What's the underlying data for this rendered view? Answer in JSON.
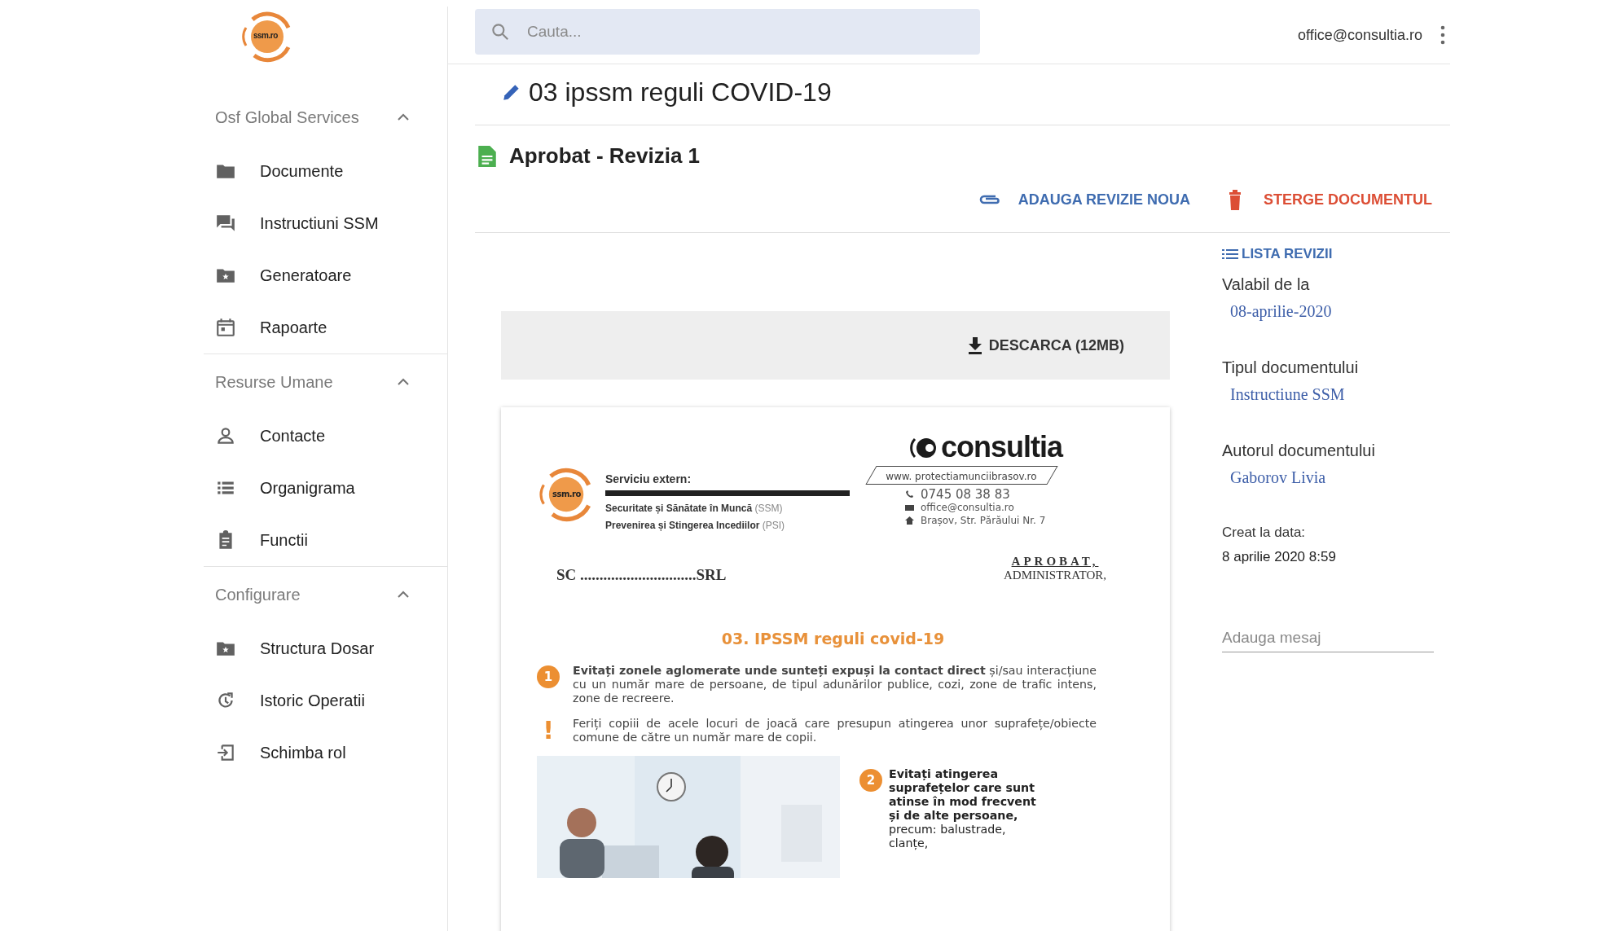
{
  "logo": {
    "text": "ssm.ro"
  },
  "sidebar": {
    "groups": [
      {
        "title": "Osf Global Services",
        "expanded": true,
        "items": [
          {
            "label": "Documente"
          },
          {
            "label": "Instructiuni SSM"
          },
          {
            "label": "Generatoare"
          },
          {
            "label": "Rapoarte"
          }
        ]
      },
      {
        "title": "Resurse Umane",
        "expanded": true,
        "items": [
          {
            "label": "Contacte"
          },
          {
            "label": "Organigrama"
          },
          {
            "label": "Functii"
          }
        ]
      },
      {
        "title": "Configurare",
        "expanded": true,
        "items": [
          {
            "label": "Structura Dosar"
          },
          {
            "label": "Istoric Operatii"
          },
          {
            "label": "Schimba rol"
          }
        ]
      }
    ]
  },
  "search": {
    "placeholder": "Cauta..."
  },
  "user": {
    "email": "office@consultia.ro"
  },
  "document": {
    "title": "03 ipssm reguli COVID-19",
    "revision": "Aprobat - Revizia 1",
    "actions": [
      {
        "kind": "add",
        "label": "ADAUGA REVIZIE NOUA"
      },
      {
        "kind": "delete",
        "label": "STERGE DOCUMENTUL"
      }
    ],
    "download": {
      "label": "DESCARCA (12MB)"
    },
    "preview": {
      "logo_text": "ssm.ro",
      "service_title": "Serviciu extern:",
      "services": [
        {
          "text": "Securitate și Sănătate în Muncă",
          "abbr": "(SSM)"
        },
        {
          "text": "Prevenirea și Stingerea Incediilor",
          "abbr": "(PSI)"
        }
      ],
      "brand": "consultia",
      "website": "www. protectiamunciibrasov.ro",
      "contacts": [
        {
          "kind": "phone",
          "text": "0745 08 38 83"
        },
        {
          "kind": "email",
          "text": "office@consultia.ro"
        },
        {
          "kind": "address",
          "text": "Brașov, Str. Părăului Nr. 7"
        }
      ],
      "company_line": "SC ..............................SRL",
      "approval": {
        "title": "APROBAT,",
        "role": "ADMINISTRATOR,"
      },
      "heading": "03. IPSSM reguli covid-19",
      "rules": [
        {
          "kind": "numbered",
          "marker": "1",
          "text": "**Evitați zonele aglomerate unde sunteți expuși la contact direct** și/sau interacțiune cu un număr mare de persoane, de tipul adunărilor publice, cozi, zone de trafic intens, zone de recreere."
        },
        {
          "kind": "warning",
          "marker": "!",
          "text": "Feriți copiii de acele locuri de joacă care presupun atingerea unor suprafețe/obiecte comune de către un număr mare de copii."
        }
      ],
      "photo_rule": {
        "marker": "2",
        "text": "**Evitați atingerea suprafețelor care sunt atinse în mod frecvent și de alte persoane,** precum: balustrade, clanțe,"
      }
    }
  },
  "details": {
    "revisions_link": "LISTA REVIZII",
    "fields": [
      {
        "kind": "link",
        "label": "Valabil de la",
        "value": "08-aprilie-2020"
      },
      {
        "kind": "link",
        "label": "Tipul documentului",
        "value": "Instructiune SSM"
      },
      {
        "kind": "link",
        "label": "Autorul documentului",
        "value": "Gaborov Livia"
      },
      {
        "kind": "plain",
        "label": "Creat la data:",
        "value": "8 aprilie 2020 8:59"
      }
    ],
    "message": {
      "placeholder": "Adauga mesaj"
    }
  }
}
